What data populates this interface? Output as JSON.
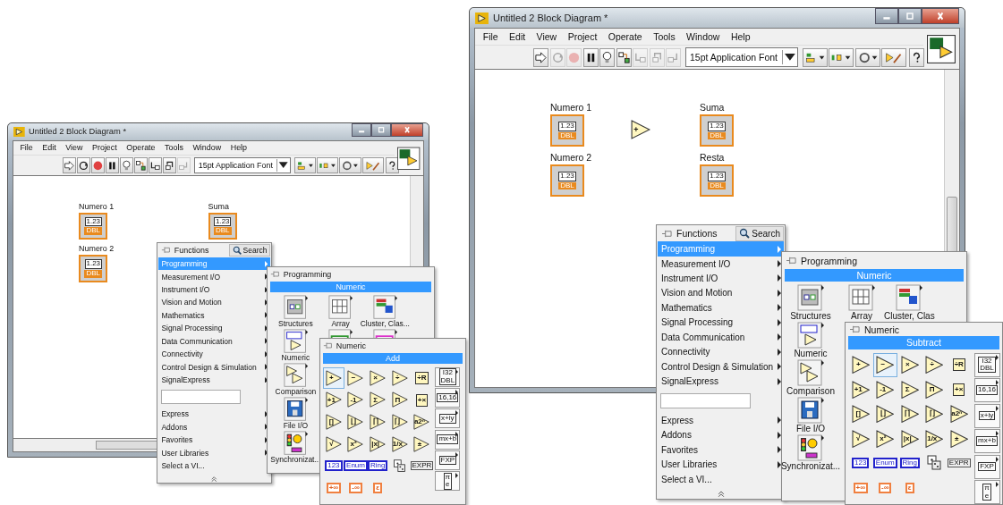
{
  "screenshots": [
    {
      "window": {
        "title": "Untitled 2 Block Diagram *",
        "menu": [
          "File",
          "Edit",
          "View",
          "Project",
          "Operate",
          "Tools",
          "Window",
          "Help"
        ],
        "run_buttons": [
          {
            "kind": "run",
            "disabled": false
          },
          {
            "kind": "run-continuously",
            "disabled": false
          },
          {
            "kind": "abort",
            "disabled": false
          },
          {
            "kind": "pause",
            "disabled": false
          },
          {
            "kind": "highlight",
            "disabled": false
          },
          {
            "kind": "retain",
            "disabled": false
          },
          {
            "kind": "step-into",
            "disabled": false
          },
          {
            "kind": "step-over",
            "disabled": false
          },
          {
            "kind": "step-out",
            "disabled": true
          }
        ],
        "font_selector": "15pt Application Font",
        "diagram": [
          {
            "kind": "control",
            "label": "Numero 1",
            "glyph": "1.23",
            "type": "DBL"
          },
          {
            "kind": "control",
            "label": "Numero 2",
            "glyph": "1.23",
            "type": "DBL"
          },
          {
            "kind": "indicator",
            "label": "Suma",
            "glyph": "1.23",
            "type": "DBL"
          }
        ]
      },
      "functions_menu": {
        "title": "Functions",
        "search": "Search",
        "categories": [
          {
            "label": "Programming",
            "selected": true,
            "submenu": true
          },
          {
            "label": "Measurement I/O",
            "selected": false,
            "submenu": true
          },
          {
            "label": "Instrument I/O",
            "selected": false,
            "submenu": true
          },
          {
            "label": "Vision and Motion",
            "selected": false,
            "submenu": true
          },
          {
            "label": "Mathematics",
            "selected": false,
            "submenu": true
          },
          {
            "label": "Signal Processing",
            "selected": false,
            "submenu": true
          },
          {
            "label": "Data Communication",
            "selected": false,
            "submenu": true
          },
          {
            "label": "Connectivity",
            "selected": false,
            "submenu": true
          },
          {
            "label": "Control Design & Simulation",
            "selected": false,
            "submenu": true
          },
          {
            "label": "SignalExpress",
            "selected": false,
            "submenu": true
          }
        ],
        "more": [
          {
            "label": "Express",
            "selected": false,
            "submenu": true
          },
          {
            "label": "Addons",
            "selected": false,
            "submenu": true
          },
          {
            "label": "Favorites",
            "selected": false,
            "submenu": true
          },
          {
            "label": "User Libraries",
            "selected": false,
            "submenu": true
          },
          {
            "label": "Select a VI...",
            "selected": false,
            "submenu": false
          }
        ]
      },
      "programming_palette": {
        "title": "Programming",
        "tooltip": "Numeric",
        "columns": [
          [
            {
              "kind": "structures",
              "label": "Structures"
            },
            {
              "kind": "numeric",
              "label": "Numeric"
            },
            {
              "kind": "comparison",
              "label": "Comparison"
            },
            {
              "kind": "file",
              "label": "File I/O"
            },
            {
              "kind": "sync",
              "label": "Synchronizat..."
            }
          ],
          [
            {
              "kind": "array",
              "label": "Array"
            },
            {
              "kind": "boolean"
            }
          ],
          [
            {
              "kind": "cluster",
              "label": "Cluster, Clas..."
            },
            {
              "kind": "string"
            }
          ]
        ]
      },
      "numeric_palette": {
        "title": "Numeric",
        "tooltip": "Add",
        "functions": [
          {
            "kind": "triangle",
            "glyph": "+",
            "selected": true
          },
          {
            "kind": "triangle",
            "glyph": "−",
            "selected": false
          },
          {
            "kind": "triangle",
            "glyph": "×",
            "selected": false
          },
          {
            "kind": "triangle",
            "glyph": "÷",
            "selected": false
          },
          {
            "kind": "box",
            "glyph": "÷R",
            "selected": false
          },
          {
            "kind": "triangle",
            "glyph": "+1",
            "selected": false
          },
          {
            "kind": "triangle",
            "glyph": "-1",
            "selected": false
          },
          {
            "kind": "triangle",
            "glyph": "Σ",
            "selected": false
          },
          {
            "kind": "triangle",
            "glyph": "Π",
            "selected": false
          },
          {
            "kind": "box",
            "glyph": "+×",
            "selected": false
          },
          {
            "kind": "triangle",
            "glyph": "[]",
            "selected": false
          },
          {
            "kind": "triangle",
            "glyph": "⌊⌋",
            "selected": false
          },
          {
            "kind": "triangle",
            "glyph": "⌈⌉",
            "selected": false
          },
          {
            "kind": "triangle",
            "glyph": "⌈⌋",
            "selected": false
          },
          {
            "kind": "triangle",
            "glyph": "a2ⁿ",
            "selected": false
          },
          {
            "kind": "triangle",
            "glyph": "√",
            "selected": false
          },
          {
            "kind": "triangle",
            "glyph": "x²",
            "selected": false
          },
          {
            "kind": "triangle",
            "glyph": "|x|",
            "selected": false
          },
          {
            "kind": "triangle",
            "glyph": "1/x",
            "selected": false
          },
          {
            "kind": "triangle",
            "glyph": "±",
            "selected": false
          },
          {
            "kind": "constant",
            "glyph": "123",
            "selected": false
          },
          {
            "kind": "constant",
            "glyph": "Enum",
            "selected": false
          },
          {
            "kind": "constant",
            "glyph": "Ring",
            "selected": false
          },
          {
            "kind": "dice",
            "selected": false
          },
          {
            "kind": "expr",
            "glyph": "EXPR",
            "selected": false
          },
          {
            "kind": "orange",
            "glyph": "+∞",
            "selected": false
          },
          {
            "kind": "orange",
            "glyph": "-∞",
            "selected": false
          },
          {
            "kind": "orange",
            "glyph": "ε",
            "selected": false
          }
        ],
        "subpalettes": [
          {
            "glyph": "I32 DBL"
          },
          {
            "glyph": "16,16"
          },
          {
            "glyph": "x+iy"
          },
          {
            "glyph": "mx+b"
          },
          {
            "glyph": "FXP"
          },
          {
            "glyph": "π e"
          }
        ]
      }
    },
    {
      "window": {
        "title": "Untitled 2 Block Diagram *",
        "menu": [
          "File",
          "Edit",
          "View",
          "Project",
          "Operate",
          "Tools",
          "Window",
          "Help"
        ],
        "run_buttons": [
          {
            "kind": "run",
            "disabled": false
          },
          {
            "kind": "run-continuously",
            "disabled": true
          },
          {
            "kind": "abort",
            "disabled": true
          },
          {
            "kind": "pause",
            "disabled": false
          },
          {
            "kind": "highlight",
            "disabled": false
          },
          {
            "kind": "retain",
            "disabled": false
          },
          {
            "kind": "step-into",
            "disabled": true
          },
          {
            "kind": "step-over",
            "disabled": true
          },
          {
            "kind": "step-out",
            "disabled": true
          }
        ],
        "font_selector": "15pt Application Font",
        "diagram": [
          {
            "kind": "control",
            "label": "Numero 1",
            "glyph": "1.23",
            "type": "DBL"
          },
          {
            "kind": "control",
            "label": "Numero 2",
            "glyph": "1.23",
            "type": "DBL"
          },
          {
            "kind": "function",
            "glyph": "+"
          },
          {
            "kind": "indicator",
            "label": "Suma",
            "glyph": "1.23",
            "type": "DBL"
          },
          {
            "kind": "indicator",
            "label": "Resta",
            "glyph": "1.23",
            "type": "DBL"
          }
        ]
      },
      "functions_menu": {
        "title": "Functions",
        "search": "Search",
        "categories": [
          {
            "label": "Programming",
            "selected": true,
            "submenu": true
          },
          {
            "label": "Measurement I/O",
            "selected": false,
            "submenu": true
          },
          {
            "label": "Instrument I/O",
            "selected": false,
            "submenu": true
          },
          {
            "label": "Vision and Motion",
            "selected": false,
            "submenu": true
          },
          {
            "label": "Mathematics",
            "selected": false,
            "submenu": true
          },
          {
            "label": "Signal Processing",
            "selected": false,
            "submenu": true
          },
          {
            "label": "Data Communication",
            "selected": false,
            "submenu": true
          },
          {
            "label": "Connectivity",
            "selected": false,
            "submenu": true
          },
          {
            "label": "Control Design & Simulation",
            "selected": false,
            "submenu": true
          },
          {
            "label": "SignalExpress",
            "selected": false,
            "submenu": true
          }
        ],
        "more": [
          {
            "label": "Express",
            "selected": false,
            "submenu": true
          },
          {
            "label": "Addons",
            "selected": false,
            "submenu": true
          },
          {
            "label": "Favorites",
            "selected": false,
            "submenu": true
          },
          {
            "label": "User Libraries",
            "selected": false,
            "submenu": true
          },
          {
            "label": "Select a VI...",
            "selected": false,
            "submenu": false
          }
        ]
      },
      "programming_palette": {
        "title": "Programming",
        "tooltip": "Numeric",
        "columns": [
          [
            {
              "kind": "structures",
              "label": "Structures"
            },
            {
              "kind": "numeric",
              "label": "Numeric"
            },
            {
              "kind": "comparison",
              "label": "Comparison"
            },
            {
              "kind": "file",
              "label": "File I/O"
            },
            {
              "kind": "sync",
              "label": "Synchronizat..."
            }
          ],
          [
            {
              "kind": "array",
              "label": "Array"
            }
          ],
          [
            {
              "kind": "cluster",
              "label": "Cluster, Clas"
            }
          ]
        ]
      },
      "numeric_palette": {
        "title": "Numeric",
        "tooltip": "Subtract",
        "functions": [
          {
            "kind": "triangle",
            "glyph": "+",
            "selected": false
          },
          {
            "kind": "triangle",
            "glyph": "−",
            "selected": true
          },
          {
            "kind": "triangle",
            "glyph": "×",
            "selected": false
          },
          {
            "kind": "triangle",
            "glyph": "÷",
            "selected": false
          },
          {
            "kind": "box",
            "glyph": "÷R",
            "selected": false
          },
          {
            "kind": "triangle",
            "glyph": "+1",
            "selected": false
          },
          {
            "kind": "triangle",
            "glyph": "-1",
            "selected": false
          },
          {
            "kind": "triangle",
            "glyph": "Σ",
            "selected": false
          },
          {
            "kind": "triangle",
            "glyph": "Π",
            "selected": false
          },
          {
            "kind": "box",
            "glyph": "+×",
            "selected": false
          },
          {
            "kind": "triangle",
            "glyph": "[]",
            "selected": false
          },
          {
            "kind": "triangle",
            "glyph": "⌊⌋",
            "selected": false
          },
          {
            "kind": "triangle",
            "glyph": "⌈⌉",
            "selected": false
          },
          {
            "kind": "triangle",
            "glyph": "⌈⌋",
            "selected": false
          },
          {
            "kind": "triangle",
            "glyph": "a2ⁿ",
            "selected": false
          },
          {
            "kind": "triangle",
            "glyph": "√",
            "selected": false
          },
          {
            "kind": "triangle",
            "glyph": "x²",
            "selected": false
          },
          {
            "kind": "triangle",
            "glyph": "|x|",
            "selected": false
          },
          {
            "kind": "triangle",
            "glyph": "1/x",
            "selected": false
          },
          {
            "kind": "triangle",
            "glyph": "±",
            "selected": false
          },
          {
            "kind": "constant",
            "glyph": "123",
            "selected": false
          },
          {
            "kind": "constant",
            "glyph": "Enum",
            "selected": false
          },
          {
            "kind": "constant",
            "glyph": "Ring",
            "selected": false
          },
          {
            "kind": "dice",
            "selected": false
          },
          {
            "kind": "expr",
            "glyph": "EXPR",
            "selected": false
          },
          {
            "kind": "orange",
            "glyph": "+∞",
            "selected": false
          },
          {
            "kind": "orange",
            "glyph": "-∞",
            "selected": false
          },
          {
            "kind": "orange",
            "glyph": "ε",
            "selected": false
          }
        ],
        "subpalettes": [
          {
            "glyph": "I32 DBL"
          },
          {
            "glyph": "16,16"
          },
          {
            "glyph": "x+iy"
          },
          {
            "glyph": "mx+b"
          },
          {
            "glyph": "FXP"
          },
          {
            "glyph": "π e"
          }
        ]
      }
    }
  ]
}
